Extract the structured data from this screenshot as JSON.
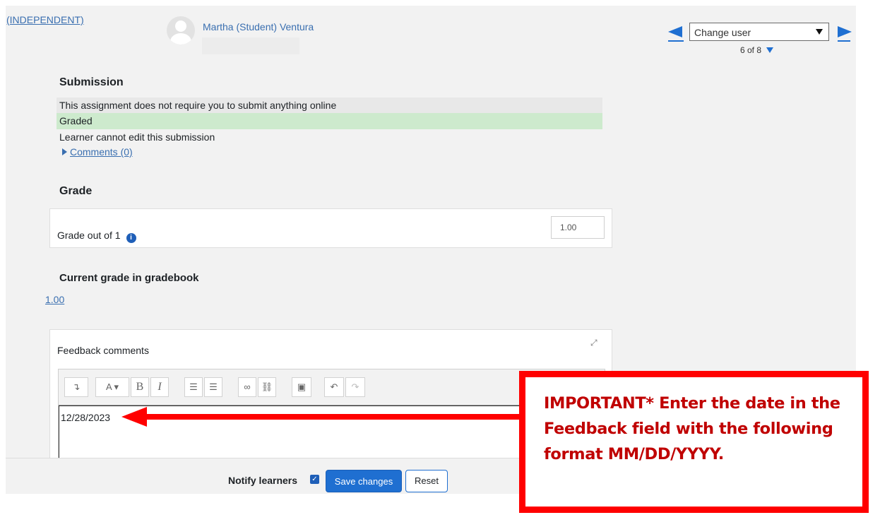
{
  "header": {
    "course_link": "(INDEPENDENT)",
    "user_name": "Martha (Student) Ventura",
    "change_user_placeholder": "Change user",
    "counter": "6 of 8"
  },
  "submission": {
    "heading": "Submission",
    "status_rows": [
      "This assignment does not require you to submit anything online",
      "Graded",
      "Learner cannot edit this submission"
    ],
    "comments_link": "Comments (0)"
  },
  "grade": {
    "heading": "Grade",
    "label": "Grade out of 1",
    "info_icon": "i",
    "value": "1.00"
  },
  "current_grade": {
    "heading": "Current grade in gradebook",
    "value": "1.00"
  },
  "feedback": {
    "label": "Feedback comments",
    "text": "12/28/2023",
    "toolbar": {
      "paragraph": "↴",
      "font_style": "A",
      "bold": "B",
      "italic": "I",
      "bullet_list": "☰",
      "numbered_list": "☰",
      "link": "∞",
      "unlink": "⛓",
      "image": "▣",
      "undo": "↶",
      "redo": "↷"
    }
  },
  "footer": {
    "notify_label": "Notify learners",
    "save_label": "Save changes",
    "reset_label": "Reset"
  },
  "callout": {
    "text": "IMPORTANT* Enter the date in the Feedback field with the following format MM/DD/YYYY.",
    "color": "#c00000",
    "border_color": "#ff0000"
  },
  "colors": {
    "accent": "#1f6fd1",
    "graded_bg": "#cdeacd"
  }
}
